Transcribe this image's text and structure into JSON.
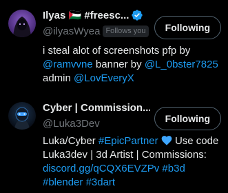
{
  "users": [
    {
      "display_name": "Ilyas 🇵🇸 #freesc...",
      "handle": "@ilyasWyea",
      "follows_you": "Follows you",
      "follow_button": "Following",
      "bio": {
        "line1": "i steal alot of screenshots pfp by",
        "mention1": "@ramvvne",
        "banner_text": "banner by",
        "mention2": "@L_0bster7825",
        "admin_text": "admin",
        "mention3": "@LovEveryX"
      }
    },
    {
      "display_name": "Cyber | Commission...",
      "handle": "@Luka3Dev",
      "follow_button": "Following",
      "bio": {
        "prefix": "Luka/Cyber",
        "hashtag1": "#EpicPartner",
        "heart_icon": "blue-heart-icon",
        "use_code": "Use code",
        "line2": "Luka3dev | 3d Artist | Commissions:",
        "link": "discord.gg/qCQX6EVZPv",
        "hashtag2": "#b3d",
        "hashtag3": "#blender",
        "hashtag4": "#3dart"
      }
    }
  ],
  "colors": {
    "background": "#000000",
    "text": "#e7e9ea",
    "secondary_text": "#71767b",
    "link": "#1d9bf0",
    "button_border": "#536471",
    "verified": "#1d9bf0"
  }
}
